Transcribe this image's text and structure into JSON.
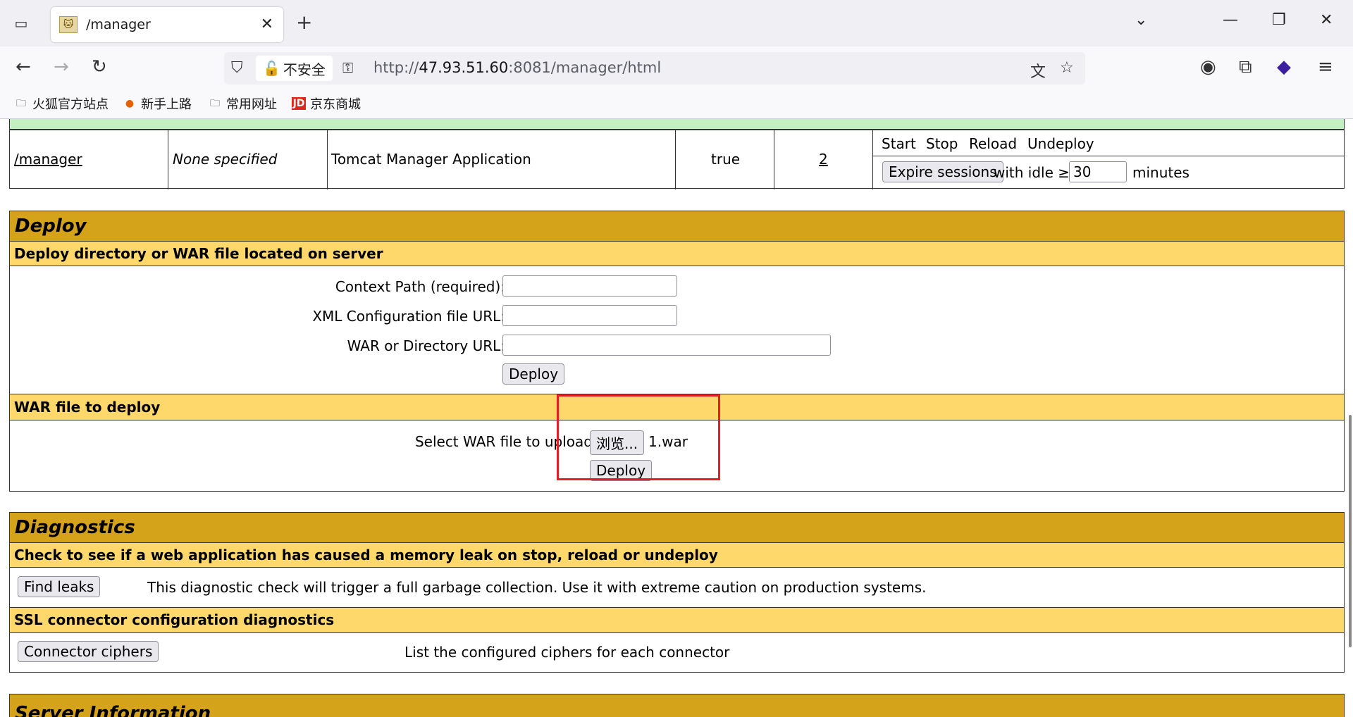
{
  "browser": {
    "tab_title": "/manager",
    "insecure_label": "不安全",
    "url_host": "47.93.51.60",
    "url_prefix": "http://",
    "url_rest": ":8081/manager/html",
    "bookmarks": [
      "火狐官方站点",
      "新手上路",
      "常用网址",
      "京东商城"
    ]
  },
  "app_row": {
    "path": "/manager",
    "version": "None specified",
    "display_name": "Tomcat Manager Application",
    "running": "true",
    "sessions": "2",
    "commands": [
      "Start",
      "Stop",
      "Reload",
      "Undeploy"
    ],
    "expire_button": "Expire sessions",
    "with_idle": "with idle ≥",
    "idle_value": "30",
    "minutes": "minutes"
  },
  "deploy": {
    "header": "Deploy",
    "server_section": "Deploy directory or WAR file located on server",
    "context_label": "Context Path (required):",
    "xml_label": "XML Configuration file URL:",
    "war_dir_label": "WAR or Directory URL:",
    "deploy_button": "Deploy",
    "war_section": "WAR file to deploy",
    "select_label": "Select WAR file to upload",
    "browse_button": "浏览...",
    "file_name": "1.war",
    "deploy_button2": "Deploy"
  },
  "diagnostics": {
    "header": "Diagnostics",
    "leak_section": "Check to see if a web application has caused a memory leak on stop, reload or undeploy",
    "find_leaks_button": "Find leaks",
    "leak_desc": "This diagnostic check will trigger a full garbage collection. Use it with extreme caution on production systems.",
    "ssl_section": "SSL connector configuration diagnostics",
    "ciphers_button": "Connector ciphers",
    "ciphers_desc": "List the configured ciphers for each connector"
  },
  "server_info": {
    "header": "Server Information"
  }
}
